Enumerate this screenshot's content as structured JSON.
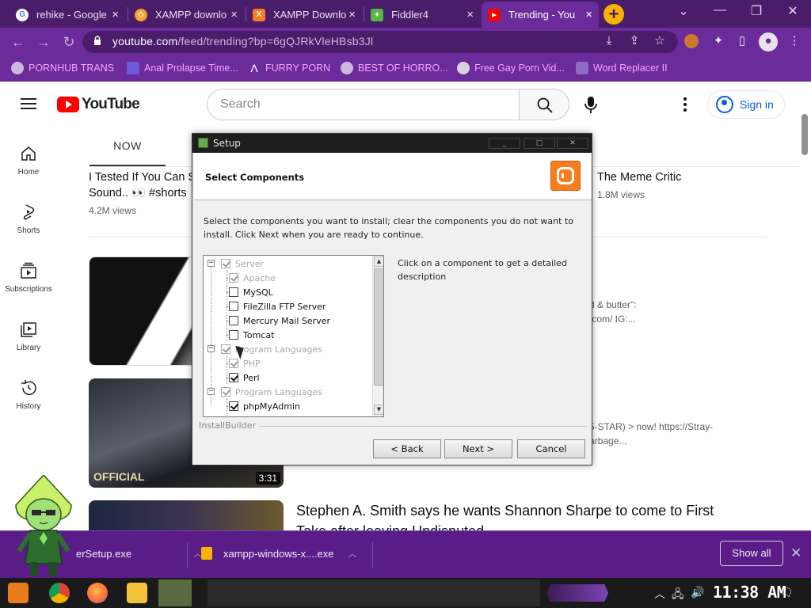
{
  "browser": {
    "tabs": [
      {
        "title": "rehike - Google",
        "favicon_color": "#e8e8e8",
        "favicon_char": "G"
      },
      {
        "title": "XAMPP downlo",
        "favicon_color": "#f6a12a",
        "favicon_char": "◇"
      },
      {
        "title": "XAMPP Downlo",
        "favicon_color": "#f77d1f",
        "favicon_char": "X"
      },
      {
        "title": "Fiddler4",
        "favicon_color": "#55b848",
        "favicon_char": "♦"
      },
      {
        "title": "Trending - You",
        "favicon_color": "#ff0000",
        "favicon_char": "▶"
      }
    ],
    "url_host": "youtube.com",
    "url_path": "/feed/trending?bp=6gQJRkVleHBsb3Jl",
    "bookmarks": [
      "PORNHUB TRANS",
      "Anal Prolapse Time...",
      "FURRY PORN",
      "BEST OF HORRO...",
      "Free Gay Porn Vid...",
      "Word Replacer II"
    ]
  },
  "youtube": {
    "logo_text": "YouTube",
    "search_placeholder": "Search",
    "signin_label": "Sign in",
    "sidenav": [
      {
        "label": "Home",
        "icon": "home-icon"
      },
      {
        "label": "Shorts",
        "icon": "shorts-icon"
      },
      {
        "label": "Subscriptions",
        "icon": "subscriptions-icon"
      },
      {
        "label": "Library",
        "icon": "library-icon"
      },
      {
        "label": "History",
        "icon": "history-icon"
      }
    ],
    "tab_now": "NOW",
    "video1": {
      "title_line1": "I Tested If You Can S",
      "title_line2": "Sound.. 👀 #shorts",
      "views": "4.2M views"
    },
    "video1b": {
      "title": "The Meme Critic",
      "views": "1.8M views"
    },
    "video2": {
      "desc_line1": "d & butter\":",
      "desc_line2": ".com/ IG:..."
    },
    "video3": {
      "duration": "3:31",
      "watermark": "OFFICIAL",
      "desc_line1": "5-STAR) >  now! https://Stray-",
      "desc_line2": "arbage..."
    },
    "video4": {
      "title_line1": "Stephen A. Smith says he wants Shannon Sharpe to come to First",
      "title_line2": "Take after leaving Undisputed"
    }
  },
  "dialog": {
    "title": "Setup",
    "heading": "Select Components",
    "description": "Select the components you want to install; clear the components you do not want to install. Click Next when you are ready to continue.",
    "detail": "Click on a component to get a detailed description",
    "installbuilder": "InstallBuilder",
    "tree": [
      {
        "label": "Server",
        "checked": true,
        "greyed": true,
        "level": 0
      },
      {
        "label": "Apache",
        "checked": true,
        "greyed": true,
        "level": 1
      },
      {
        "label": "MySQL",
        "checked": false,
        "greyed": false,
        "level": 1
      },
      {
        "label": "FileZilla FTP Server",
        "checked": false,
        "greyed": false,
        "level": 1
      },
      {
        "label": "Mercury Mail Server",
        "checked": false,
        "greyed": false,
        "level": 1
      },
      {
        "label": "Tomcat",
        "checked": false,
        "greyed": false,
        "level": 1
      },
      {
        "label": "Program Languages",
        "checked": true,
        "greyed": true,
        "level": 0
      },
      {
        "label": "PHP",
        "checked": true,
        "greyed": true,
        "level": 1
      },
      {
        "label": "Perl",
        "checked": true,
        "greyed": false,
        "level": 1
      },
      {
        "label": "Program Languages",
        "checked": true,
        "greyed": true,
        "level": 0
      },
      {
        "label": "phpMyAdmin",
        "checked": true,
        "greyed": false,
        "level": 1
      }
    ],
    "buttons": {
      "back": "< Back",
      "next": "Next >",
      "cancel": "Cancel"
    }
  },
  "downloads": {
    "items": [
      "erSetup.exe",
      "xampp-windows-x....exe"
    ],
    "show_all": "Show all"
  },
  "taskbar": {
    "clock": "11:38 AM"
  }
}
